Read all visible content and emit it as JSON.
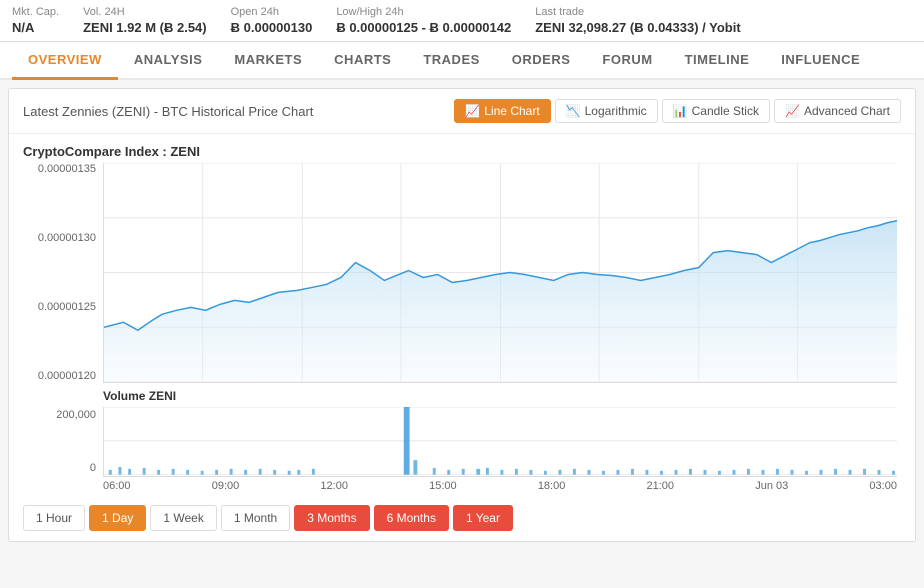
{
  "topbar": {
    "mkt_cap_label": "Mkt. Cap.",
    "mkt_cap_value": "N/A",
    "vol24h_label": "Vol. 24H",
    "vol24h_value": "ZENI 1.92 M (Ƀ 2.54)",
    "open24h_label": "Open 24h",
    "open24h_value": "Ƀ 0.00000130",
    "lowhigh_label": "Low/High 24h",
    "lowhigh_value": "Ƀ 0.00000125 - Ƀ 0.00000142",
    "lasttrade_label": "Last trade",
    "lasttrade_value": "ZENI 32,098.27 (Ƀ 0.04333) / Yobit"
  },
  "nav": {
    "tabs": [
      {
        "id": "overview",
        "label": "OVERVIEW",
        "active": true
      },
      {
        "id": "analysis",
        "label": "ANALYSIS",
        "active": false
      },
      {
        "id": "markets",
        "label": "MARKETS",
        "active": false
      },
      {
        "id": "charts",
        "label": "CHARTS",
        "active": false
      },
      {
        "id": "trades",
        "label": "TRADES",
        "active": false
      },
      {
        "id": "orders",
        "label": "ORDERS",
        "active": false
      },
      {
        "id": "forum",
        "label": "FORUM",
        "active": false
      },
      {
        "id": "timeline",
        "label": "TIMELINE",
        "active": false
      },
      {
        "id": "influence",
        "label": "INFLUENCE",
        "active": false
      }
    ]
  },
  "chart": {
    "title": "Latest Zennies (ZENI) - BTC Historical Price Chart",
    "subtitle": "CryptoCompare Index : ZENI",
    "volume_subtitle": "Volume ZENI",
    "buttons": [
      {
        "id": "line",
        "label": "Line Chart",
        "icon": "📈",
        "active": true
      },
      {
        "id": "log",
        "label": "Logarithmic",
        "icon": "📉",
        "active": false
      },
      {
        "id": "candle",
        "label": "Candle Stick",
        "icon": "📊",
        "active": false
      },
      {
        "id": "advanced",
        "label": "Advanced Chart",
        "icon": "📈",
        "active": false
      }
    ],
    "y_labels": [
      "0.00000135",
      "0.00000130",
      "0.00000125",
      "0.00000120"
    ],
    "vol_labels": [
      "200,000",
      "0"
    ],
    "x_labels": [
      "06:00",
      "09:00",
      "12:00",
      "15:00",
      "18:00",
      "21:00",
      "Jun 03",
      "03:00"
    ]
  },
  "time_range": {
    "buttons": [
      {
        "id": "1h",
        "label": "1 Hour",
        "state": "normal"
      },
      {
        "id": "1d",
        "label": "1 Day",
        "state": "active-orange"
      },
      {
        "id": "1w",
        "label": "1 Week",
        "state": "normal"
      },
      {
        "id": "1m",
        "label": "1 Month",
        "state": "normal"
      },
      {
        "id": "3m",
        "label": "3 Months",
        "state": "active-red"
      },
      {
        "id": "6m",
        "label": "6 Months",
        "state": "active-red"
      },
      {
        "id": "1y",
        "label": "1 Year",
        "state": "active-red"
      }
    ]
  }
}
